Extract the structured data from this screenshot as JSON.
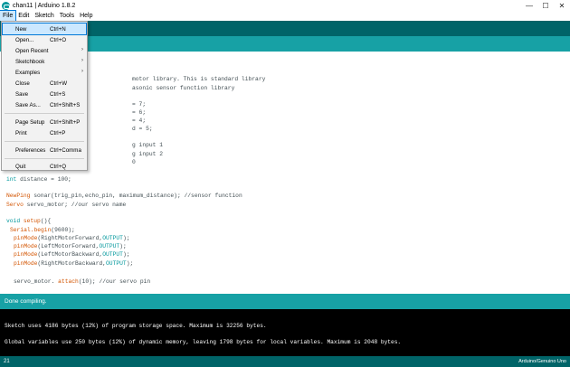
{
  "window": {
    "title": "chan11 | Arduino 1.8.2",
    "controls": {
      "minimize": "—",
      "maximize": "☐",
      "close": "✕"
    }
  },
  "menubar": {
    "items": [
      {
        "label": "File"
      },
      {
        "label": "Edit"
      },
      {
        "label": "Sketch"
      },
      {
        "label": "Tools"
      },
      {
        "label": "Help"
      }
    ]
  },
  "file_menu": {
    "items": [
      {
        "label": "New",
        "shortcut": "Ctrl+N",
        "submenu": false
      },
      {
        "label": "Open...",
        "shortcut": "Ctrl+O",
        "submenu": false
      },
      {
        "label": "Open Recent",
        "shortcut": "",
        "submenu": true
      },
      {
        "label": "Sketchbook",
        "shortcut": "",
        "submenu": true
      },
      {
        "label": "Examples",
        "shortcut": "",
        "submenu": true
      },
      {
        "label": "Close",
        "shortcut": "Ctrl+W",
        "submenu": false
      },
      {
        "label": "Save",
        "shortcut": "Ctrl+S",
        "submenu": false
      },
      {
        "label": "Save As...",
        "shortcut": "Ctrl+Shift+S",
        "submenu": false
      },
      {
        "label": "Page Setup",
        "shortcut": "Ctrl+Shift+P",
        "submenu": false
      },
      {
        "label": "Print",
        "shortcut": "Ctrl+P",
        "submenu": false
      },
      {
        "label": "Preferences",
        "shortcut": "Ctrl+Comma",
        "submenu": false
      },
      {
        "label": "Quit",
        "shortcut": "Ctrl+Q",
        "submenu": false
      }
    ],
    "submenu_arrow": "›"
  },
  "editor": {
    "visible_code": {
      "l1": "motor library. This is standard library",
      "l2": "asonic sensor function library",
      "l3": "= 7;",
      "l4": "= 6;",
      "l5": "= 4;",
      "l6": "d = 5;",
      "l7": "g input 1",
      "l8": "g input 2",
      "l9": "0",
      "l10_type": "int",
      "l10_rest": " distance = 100;",
      "l11_type": "NewPing",
      "l11_rest": " sonar(trig_pin,echo_pin, maximum_distance); //sensor function",
      "l12_type": "Servo",
      "l12_rest": " servo_motor; //our servo name",
      "l13_type": "void",
      "l13_func": " setup",
      "l13_rest": "(){",
      "l14_obj": "Serial",
      "l14_func": ".begin",
      "l14_rest": "(9600);",
      "l15_func": "pinMode",
      "l15_args": "(RightMotorForward,",
      "l15_const": "OUTPUT",
      "l15_end": ");",
      "l16_func": "pinMode",
      "l16_args": "(LeftMotorForward,",
      "l16_const": "OUTPUT",
      "l16_end": ");",
      "l17_func": "pinMode",
      "l17_args": "(LeftMotorBackward,",
      "l17_const": "OUTPUT",
      "l17_end": ");",
      "l18_func": "pinMode",
      "l18_args": "(RightMotorBackward,",
      "l18_const": "OUTPUT",
      "l18_end": ");",
      "l19_a": "servo_motor.",
      "l19_func": " attach",
      "l19_rest": "(10); //our servo pin"
    }
  },
  "status": {
    "message": "Done compiling."
  },
  "console": {
    "line1": "Sketch uses 4186 bytes (12%) of program storage space. Maximum is 32256 bytes.",
    "line2": "Global variables use 250 bytes (12%) of dynamic memory, leaving 1798 bytes for local variables. Maximum is 2048 bytes."
  },
  "footer": {
    "line_number": "21",
    "board": "Arduino/Genuino Uno"
  },
  "colors": {
    "toolbar": "#006468",
    "tabbar": "#17a1a5",
    "console_bg": "#000000",
    "keyword": "#00979c",
    "function": "#d35400"
  }
}
